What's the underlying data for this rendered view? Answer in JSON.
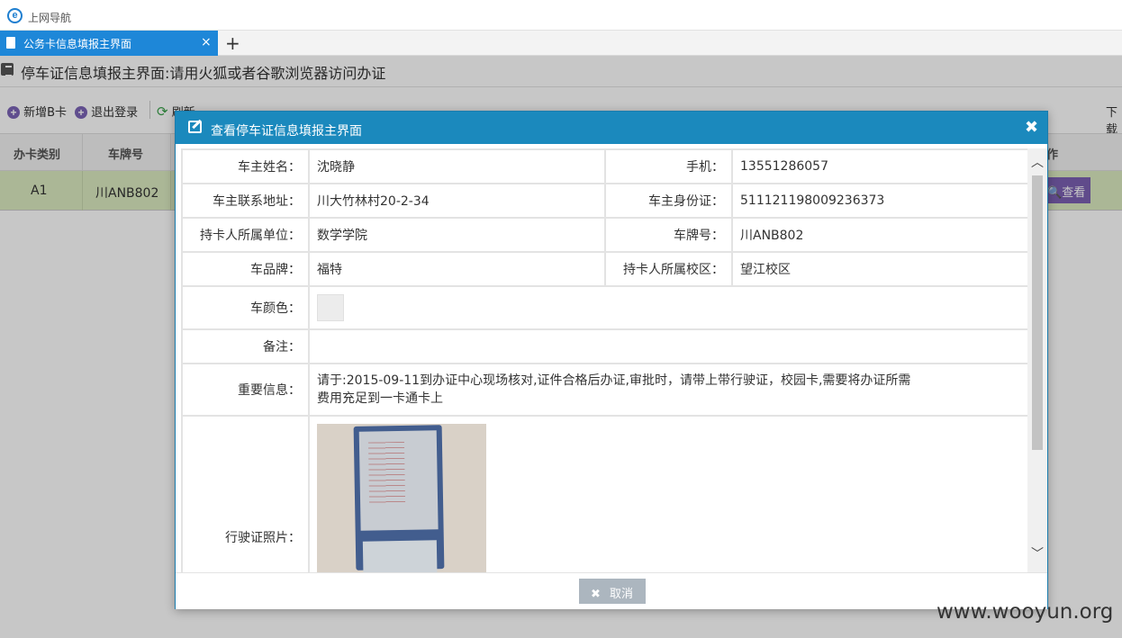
{
  "browser": {
    "nav_label": "上网导航",
    "tab_title": "公务卡信息填报主界面",
    "close_glyph": "×",
    "new_tab_glyph": "+"
  },
  "page": {
    "title": "停车证信息填报主界面:请用火狐或者谷歌浏览器访问办证",
    "toolbar": {
      "add_label": "新增B卡",
      "logout_label": "退出登录",
      "refresh_label": "刷新",
      "right_label": "下载"
    },
    "grid": {
      "columns": [
        "办卡类别",
        "车牌号",
        "作"
      ],
      "row": {
        "card_type": "A1",
        "plate": "川ANB802",
        "action": "查看"
      }
    }
  },
  "dialog": {
    "title": "查看停车证信息填报主界面",
    "close_glyph": "✖",
    "fields": {
      "owner_name_label": "车主姓名：",
      "owner_name": "沈晓静",
      "phone_label": "手机：",
      "phone": "13551286057",
      "address_label": "车主联系地址：",
      "address": "川大竹林村20-2-34",
      "id_label": "车主身份证：",
      "id": "511121198009236373",
      "unit_label": "持卡人所属单位：",
      "unit": "数学学院",
      "plate_label": "车牌号：",
      "plate": "川ANB802",
      "brand_label": "车品牌：",
      "brand": "福特",
      "campus_label": "持卡人所属校区：",
      "campus": "望江校区",
      "color_label": "车颜色：",
      "color_value": "#ececec",
      "remark_label": "备注：",
      "remark": "",
      "important_label": "重要信息：",
      "important_line1": "请于:2015-09-11到办证中心现场核对,证件合格后办证,审批时，请带上带行驶证，校园卡,需要将办证所需",
      "important_line2": "费用充足到一卡通卡上",
      "license_photo_label": "行驶证照片："
    },
    "cancel_label": "取消"
  },
  "watermark": "www.wooyun.org",
  "colors": {
    "tab_active": "#1e87d8",
    "dialog_header": "#1b89bd",
    "row_selected": "#dcebc1",
    "view_button": "#7b61b3",
    "cancel_button": "#acb6bf"
  }
}
